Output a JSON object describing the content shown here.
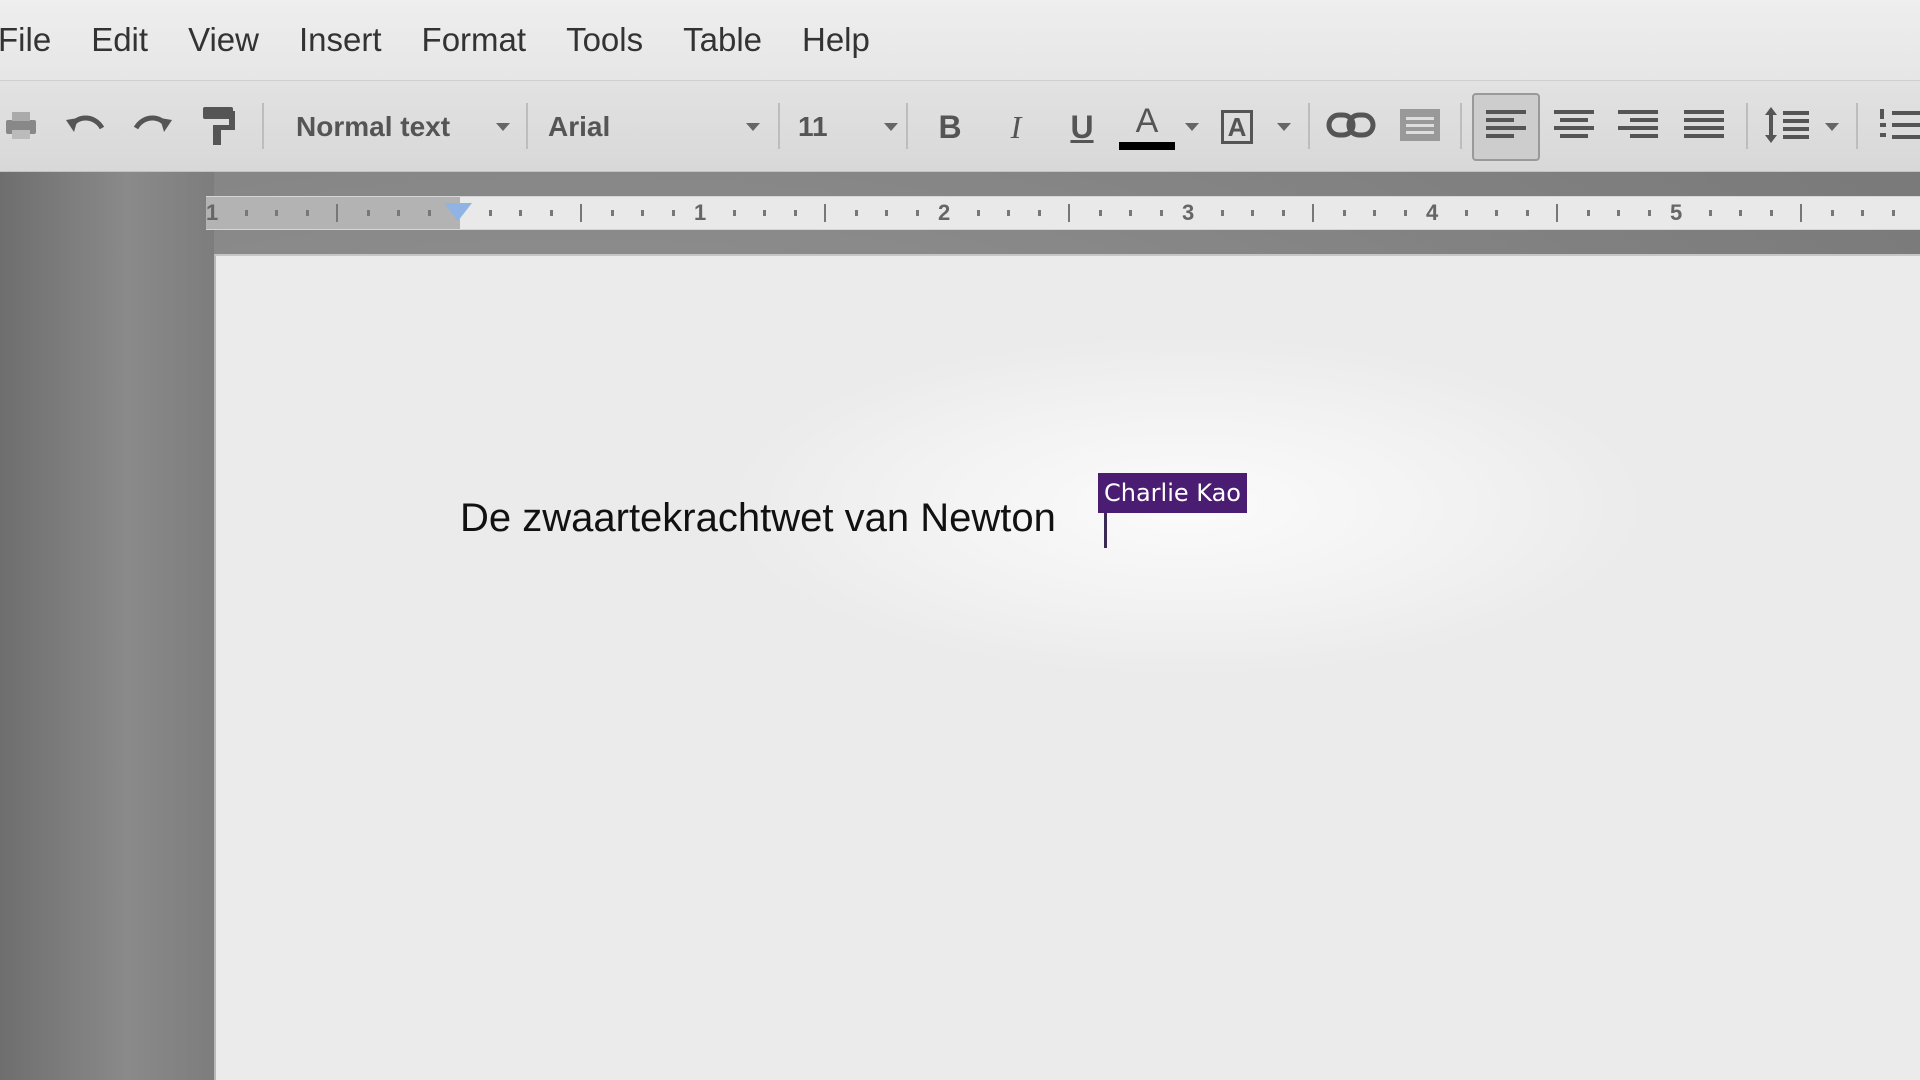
{
  "menu": [
    "File",
    "Edit",
    "View",
    "Insert",
    "Format",
    "Tools",
    "Table",
    "Help"
  ],
  "toolbar": {
    "style_select": "Normal text",
    "font_select": "Arial",
    "size_select": "11",
    "bold_label": "B",
    "italic_label": "I",
    "underline_label": "U",
    "text_color_label": "A",
    "highlight_label": "A",
    "text_color_value": "#000000",
    "active_alignment": "align-left"
  },
  "icons": [
    "print-icon",
    "undo-icon",
    "redo-icon",
    "paint-format-icon",
    "link-icon",
    "comment-icon",
    "align-left-icon",
    "align-center-icon",
    "align-right-icon",
    "align-justify-icon",
    "line-spacing-icon",
    "numbered-list-icon"
  ],
  "ruler": {
    "numbers": [
      "1",
      "1",
      "2",
      "3",
      "4",
      "5"
    ]
  },
  "document": {
    "text": "De zwaartekrachtwet van Newton"
  },
  "collaborator": {
    "name": "Charlie Kao",
    "color": "#4b1d72"
  }
}
